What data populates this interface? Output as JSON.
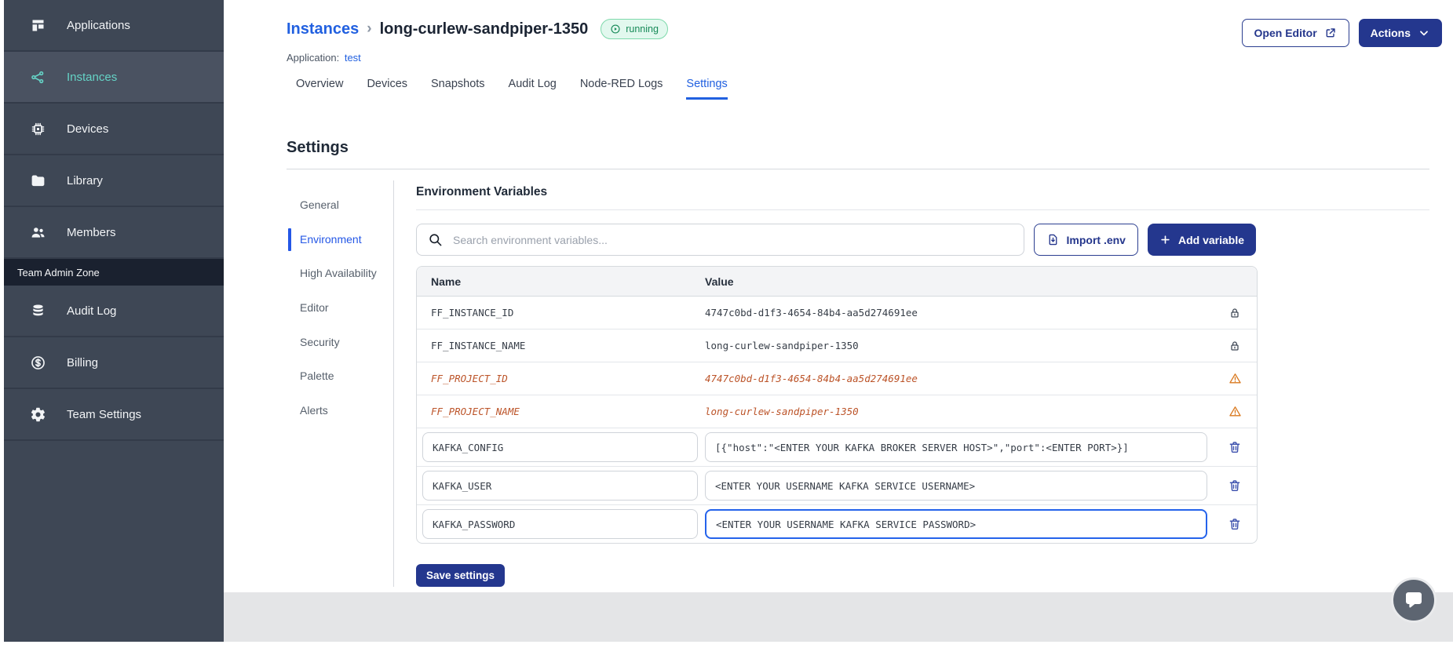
{
  "header": {
    "breadcrumb_root": "Instances",
    "instance_name": "long-curlew-sandpiper-1350",
    "status": "running",
    "application_label": "Application:",
    "application_name": "test",
    "open_editor_label": "Open Editor",
    "actions_label": "Actions"
  },
  "sidebar": {
    "section_label": "Team Admin Zone",
    "items": [
      {
        "label": "Applications",
        "icon": "applications-icon",
        "active": false
      },
      {
        "label": "Instances",
        "icon": "instances-icon",
        "active": true
      },
      {
        "label": "Devices",
        "icon": "chip-icon",
        "active": false
      },
      {
        "label": "Library",
        "icon": "folder-icon",
        "active": false
      },
      {
        "label": "Members",
        "icon": "users-icon",
        "active": false
      }
    ],
    "admin_items": [
      {
        "label": "Audit Log",
        "icon": "database-icon"
      },
      {
        "label": "Billing",
        "icon": "dollar-icon"
      },
      {
        "label": "Team Settings",
        "icon": "gear-icon"
      }
    ]
  },
  "tabs": {
    "items": [
      "Overview",
      "Devices",
      "Snapshots",
      "Audit Log",
      "Node-RED Logs",
      "Settings"
    ],
    "active": "Settings"
  },
  "settings": {
    "title": "Settings",
    "nav": {
      "items": [
        "General",
        "Environment",
        "High Availability",
        "Editor",
        "Security",
        "Palette",
        "Alerts"
      ],
      "active": "Environment"
    },
    "section_title": "Environment Variables",
    "search_placeholder": "Search environment variables...",
    "import_label": "Import .env",
    "add_label": "Add variable",
    "save_label": "Save settings",
    "table": {
      "columns": [
        "Name",
        "Value"
      ],
      "rows": [
        {
          "name": "FF_INSTANCE_ID",
          "value": "4747c0bd-d1f3-4654-84b4-aa5d274691ee",
          "type": "locked"
        },
        {
          "name": "FF_INSTANCE_NAME",
          "value": "long-curlew-sandpiper-1350",
          "type": "locked"
        },
        {
          "name": "FF_PROJECT_ID",
          "value": "4747c0bd-d1f3-4654-84b4-aa5d274691ee",
          "type": "deprecated"
        },
        {
          "name": "FF_PROJECT_NAME",
          "value": "long-curlew-sandpiper-1350",
          "type": "deprecated"
        },
        {
          "name": "KAFKA_CONFIG",
          "value": "[{\"host\":\"<ENTER YOUR KAFKA BROKER SERVER HOST>\",\"port\":<ENTER PORT>}]",
          "type": "editable",
          "focused": false
        },
        {
          "name": "KAFKA_USER",
          "value": "<ENTER YOUR USERNAME KAFKA SERVICE USERNAME>",
          "type": "editable",
          "focused": false
        },
        {
          "name": "KAFKA_PASSWORD",
          "value": "<ENTER YOUR USERNAME KAFKA SERVICE PASSWORD>",
          "type": "editable",
          "focused": true
        }
      ]
    }
  },
  "colors": {
    "navy": "#24378e",
    "link_blue": "#2160e0",
    "teal_active": "#65d3c6",
    "sidebar_bg": "#3e4755",
    "running_green": "#178a58",
    "deprecated_orange": "#bc5429",
    "warning_orange": "#d9791f",
    "focus_blue": "#2563eb"
  }
}
